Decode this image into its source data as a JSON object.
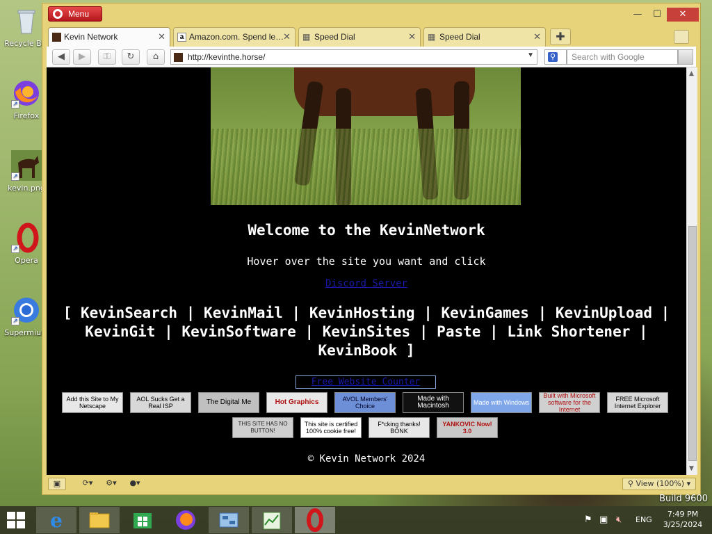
{
  "desktop": {
    "icons": [
      {
        "label": "Recycle Bin"
      },
      {
        "label": "Firefox"
      },
      {
        "label": "kevin.png"
      },
      {
        "label": "Opera"
      },
      {
        "label": "Supermium"
      }
    ],
    "build_text": "Build 9600"
  },
  "browser": {
    "menu_label": "Menu",
    "tabs": [
      {
        "title": "Kevin Network",
        "active": true
      },
      {
        "title": "Amazon.com. Spend le…",
        "active": false
      },
      {
        "title": "Speed Dial",
        "active": false
      },
      {
        "title": "Speed Dial",
        "active": false
      }
    ],
    "url": "http://kevinthe.horse/",
    "search_placeholder": "Search with Google",
    "zoom_label": "View (100%)"
  },
  "page": {
    "welcome": "Welcome to the KevinNetwork",
    "hover_text": "Hover over the site you want and click",
    "discord_link": "Discord Server",
    "links_open": "[",
    "links_close": "]",
    "links_sep": "|",
    "links": [
      "KevinSearch",
      "KevinMail",
      "KevinHosting",
      "KevinGames",
      "KevinUpload",
      "KevinGit",
      "KevinSoftware",
      "KevinSites",
      "Paste",
      "Link Shortener",
      "KevinBook"
    ],
    "counter_link": "Free Website Counter",
    "badges_row1": [
      "Add this Site to My Netscape",
      "AOL Sucks Get a Real ISP",
      "The Digital Me",
      "Hot Graphics",
      "AVOL Members' Choice",
      "Made with Macintosh",
      "Made with Windows",
      "Built with Microsoft software for the Internet",
      "FREE Microsoft Internet Explorer"
    ],
    "badges_row2": [
      "THIS SITE HAS NO BUTTON!",
      "This site is certified 100% cookie free!",
      "F*cking thanks! BONK",
      "YANKOVIC Now! 3.0"
    ],
    "footer": "© Kevin Network 2024"
  },
  "taskbar": {
    "language": "ENG",
    "time": "7:49 PM",
    "date": "3/25/2024"
  },
  "colors": {
    "window_frame": "#e6d37a",
    "page_bg": "#000000",
    "link_blue": "#1a1aa8",
    "opera_red": "#cc1c1f"
  }
}
